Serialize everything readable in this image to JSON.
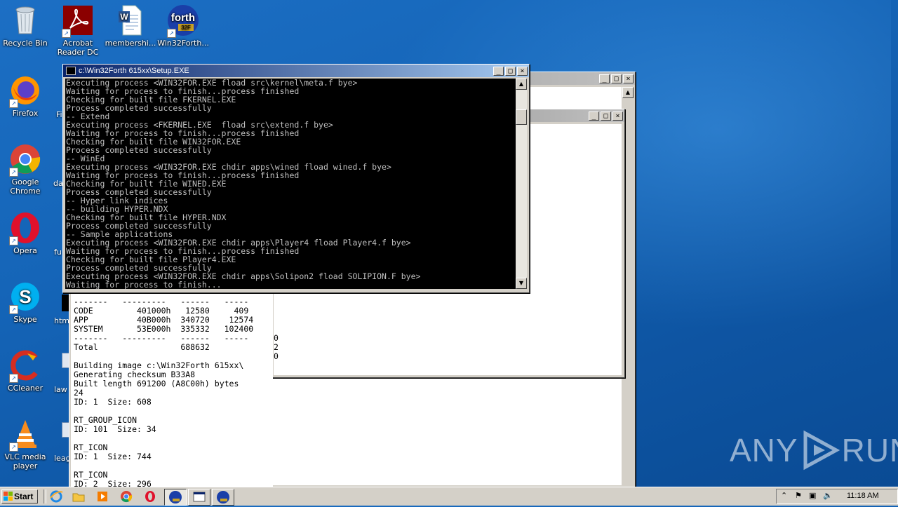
{
  "desktop": {
    "icons": [
      {
        "label_1": "Recycle Bin",
        "label_2": "",
        "icon": "recycle-bin-icon"
      },
      {
        "label_1": "Acrobat",
        "label_2": "Reader DC",
        "icon": "acrobat-icon"
      },
      {
        "label_1": "membershi...",
        "label_2": "",
        "icon": "word-document-icon"
      },
      {
        "label_1": "Win32Forth...",
        "label_2": "",
        "icon": "forth-icon"
      },
      {
        "label_1": "Firefox",
        "label_2": "",
        "icon": "firefox-icon"
      },
      {
        "label_1": "Google",
        "label_2": "Chrome",
        "icon": "chrome-icon"
      },
      {
        "label_1": "Opera",
        "label_2": "",
        "icon": "opera-icon"
      },
      {
        "label_1": "Skype",
        "label_2": "",
        "icon": "skype-icon"
      },
      {
        "label_1": "CCleaner",
        "label_2": "",
        "icon": "ccleaner-icon"
      },
      {
        "label_1": "VLC media",
        "label_2": "player",
        "icon": "vlc-icon"
      }
    ],
    "partial_labels": [
      "Fi",
      "da",
      "fu",
      "html",
      "law",
      "leag"
    ]
  },
  "forth_icon_text": "forth",
  "forth_icon_sub": "32F",
  "console_window": {
    "title": "c:\\Win32Forth 615xx\\Setup.EXE",
    "lines": [
      "Executing process <WIN32FOR.EXE fload src\\kernel\\meta.f bye>",
      "Waiting for process to finish...process finished",
      "Checking for built file FKERNEL.EXE",
      "Process completed successfully",
      "-- Extend",
      "Executing process <FKERNEL.EXE  fload src\\extend.f bye>",
      "Waiting for process to finish...process finished",
      "Checking for built file WIN32FOR.EXE",
      "Process completed successfully",
      "-- WinEd",
      "Executing process <WIN32FOR.EXE chdir apps\\wined fload wined.f bye>",
      "Waiting for process to finish...process finished",
      "Checking for built file WINED.EXE",
      "Process completed successfully",
      "-- Hyper link indices",
      "-- building HYPER.NDX",
      "Checking for built file HYPER.NDX",
      "Process completed successfully",
      "-- Sample applications",
      "Executing process <WIN32FOR.EXE chdir apps\\Player4 fload Player4.f bye>",
      "Waiting for process to finish...process finished",
      "Checking for built file Player4.EXE",
      "Process completed successfully",
      "Executing process <WIN32FOR.EXE chdir apps\\Solipon2 fload SOLIPION.F bye>",
      "Waiting for process to finish..."
    ]
  },
  "back_output": {
    "lines": [
      "-------   ---------   ------   -----",
      "CODE         401000h   12580     409",
      "APP          40B000h  340720    12574",
      "SYSTEM       53E000h  335332   102400",
      "-------   ---------   ------   -----",
      "Total                 688632",
      "",
      "Building image c:\\Win32Forth 615xx\\",
      "Generating checksum B33A8",
      "Built length 691200 (A8C00h) bytes",
      "24",
      "ID: 1  Size: 608",
      "",
      "RT_GROUP_ICON",
      "ID: 101  Size: 34",
      "",
      "RT_ICON",
      "ID: 1  Size: 744",
      "",
      "RT_ICON",
      "ID: 2  Size: 296"
    ],
    "right_fragments": [
      "0",
      "2",
      "0"
    ]
  },
  "taskbar": {
    "start_label": "Start",
    "clock": "11:18 AM"
  },
  "watermark": {
    "text_left": "ANY",
    "text_right": "RUN"
  }
}
